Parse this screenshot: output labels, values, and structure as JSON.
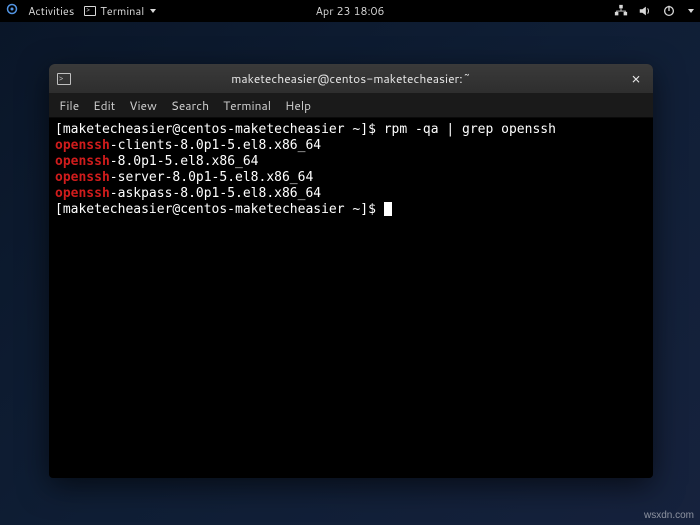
{
  "topbar": {
    "activities": "Activities",
    "app_label": "Terminal",
    "datetime": "Apr 23  18:06"
  },
  "window": {
    "title": "maketecheasier@centos-maketecheasier:~"
  },
  "menubar": {
    "file": "File",
    "edit": "Edit",
    "view": "View",
    "search": "Search",
    "terminal": "Terminal",
    "help": "Help"
  },
  "term": {
    "prompt1_pre": "[maketecheasier@centos-maketecheasier ~]$ ",
    "cmd1": "rpm -qa | grep openssh",
    "match": "openssh",
    "l1_rest": "-clients-8.0p1-5.el8.x86_64",
    "l2_rest": "-8.0p1-5.el8.x86_64",
    "l3_rest": "-server-8.0p1-5.el8.x86_64",
    "l4_rest": "-askpass-8.0p1-5.el8.x86_64",
    "prompt2": "[maketecheasier@centos-maketecheasier ~]$ "
  },
  "watermark": "wsxdn.com"
}
